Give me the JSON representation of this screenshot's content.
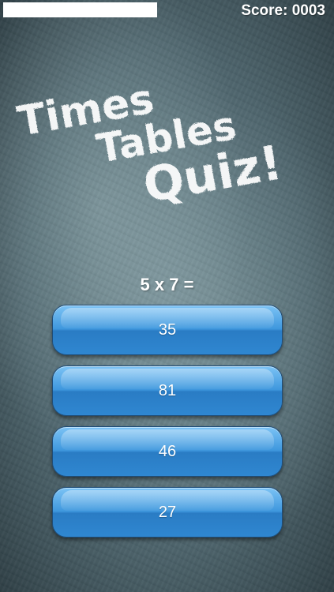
{
  "header": {
    "score_text": "Score: 0003",
    "progress": 1.0
  },
  "title": {
    "line1": "Times",
    "line2": "Tables",
    "line3": "Quiz!"
  },
  "quiz": {
    "question": "5 x 7 =",
    "answers": [
      {
        "label": "35"
      },
      {
        "label": "81"
      },
      {
        "label": "46"
      },
      {
        "label": "27"
      }
    ]
  },
  "colors": {
    "button_blue": "#2f87d1",
    "chalk_white": "#ffffff"
  }
}
